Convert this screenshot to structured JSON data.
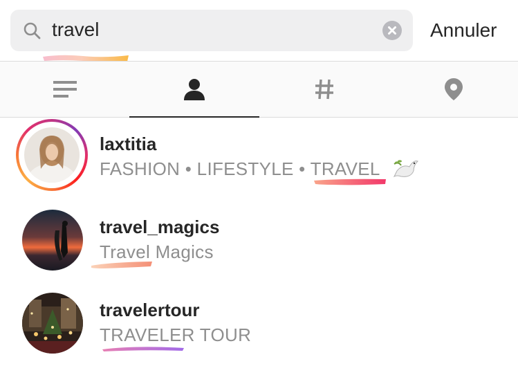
{
  "search": {
    "query": "travel",
    "cancel_label": "Annuler",
    "icon": "search-icon",
    "clear_icon": "clear-icon"
  },
  "tabs": [
    {
      "name": "top",
      "icon": "list-icon",
      "active": false
    },
    {
      "name": "accounts",
      "icon": "person-icon",
      "active": true
    },
    {
      "name": "tags",
      "icon": "hashtag-icon",
      "active": false
    },
    {
      "name": "places",
      "icon": "location-pin-icon",
      "active": false
    }
  ],
  "results": [
    {
      "username": "laxtitia",
      "full_name": "FASHION • LIFESTYLE • TRAVEL",
      "emoji": "dove-icon",
      "has_story": true
    },
    {
      "username": "travel_magics",
      "full_name": "Travel Magics",
      "has_story": false
    },
    {
      "username": "travelertour",
      "full_name": "TRAVELER TOUR",
      "has_story": false
    }
  ],
  "colors": {
    "search_bg": "#efeff0",
    "tab_bar_bg": "#fafafa",
    "text_primary": "#262626",
    "text_secondary": "#8e8e8e",
    "icon_grey": "#8e8e8e",
    "active_indicator": "#262626"
  }
}
